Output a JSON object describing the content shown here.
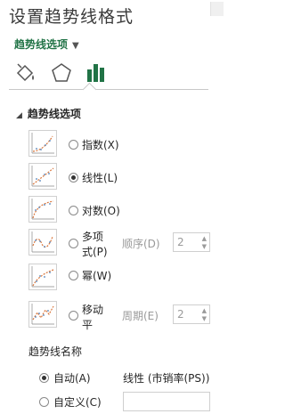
{
  "pane": {
    "title": "设置趋势线格式",
    "subheader": "趋势线选项"
  },
  "tabs": [
    {
      "icon": "paint-bucket-icon"
    },
    {
      "icon": "pentagon-effects-icon"
    },
    {
      "icon": "bar-chart-options-icon",
      "active": true
    }
  ],
  "section": {
    "title": "趋势线选项",
    "types": [
      {
        "label": "指数(X)",
        "selected": false,
        "thumb": "exponential-trend-icon"
      },
      {
        "label": "线性(L)",
        "selected": true,
        "thumb": "linear-trend-icon"
      },
      {
        "label": "对数(O)",
        "selected": false,
        "thumb": "logarithmic-trend-icon"
      },
      {
        "label_line1": "多项",
        "label_line2": "式(P)",
        "selected": false,
        "thumb": "polynomial-trend-icon",
        "param_label": "顺序(D)",
        "param_value": "2"
      },
      {
        "label": "幂(W)",
        "selected": false,
        "thumb": "power-trend-icon"
      },
      {
        "label_line1": "移动",
        "label_line2": "平",
        "selected": false,
        "thumb": "moving-average-trend-icon",
        "param_label": "周期(E)",
        "param_value": "2"
      }
    ],
    "name_group": {
      "title": "趋势线名称",
      "auto_label": "自动(A)",
      "auto_value": "线性 (市销率(PS))",
      "auto_selected": true,
      "custom_label": "自定义(C)",
      "custom_value": ""
    }
  }
}
